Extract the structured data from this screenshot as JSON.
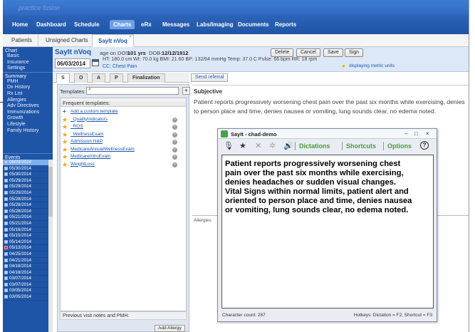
{
  "app": {
    "brand": "practice fusion"
  },
  "mainnav": {
    "items": [
      {
        "label": "Home"
      },
      {
        "label": "Dashboard"
      },
      {
        "label": "Schedule"
      },
      {
        "label": "Charts"
      },
      {
        "label": "eRx"
      },
      {
        "label": "Messages"
      },
      {
        "label": "Labs/Imaging"
      },
      {
        "label": "Documents"
      },
      {
        "label": "Reports"
      }
    ],
    "active": "Charts"
  },
  "subtabs": {
    "items": [
      {
        "label": "Patients"
      },
      {
        "label": "Unsigned Charts"
      },
      {
        "label": "SayIt nVoq"
      }
    ],
    "close_glyph": "×"
  },
  "sidebar": {
    "chart_head": "Chart",
    "chart_items": [
      "Basic",
      "Insurance",
      "Settings"
    ],
    "summary_head": "Summary",
    "summary_items": [
      "PMH",
      "Dx History",
      "Rx List",
      "Allergies",
      "Adv Directives",
      "Immunizations",
      "Growth",
      "Lifestyle",
      "Family History"
    ],
    "events_head": "Events",
    "events": [
      {
        "date": "06/03/2014",
        "selected": true
      },
      {
        "date": "05/30/2014"
      },
      {
        "date": "05/30/2014"
      },
      {
        "date": "05/29/2014"
      },
      {
        "date": "05/29/2014"
      },
      {
        "date": "05/29/2014"
      },
      {
        "date": "05/28/2014"
      },
      {
        "date": "05/28/2014"
      },
      {
        "date": "05/28/2014"
      },
      {
        "date": "05/21/2014"
      },
      {
        "date": "05/21/2014"
      },
      {
        "date": "05/16/2014"
      },
      {
        "date": "05/15/2014"
      },
      {
        "date": "05/14/2014"
      },
      {
        "date": "05/13/2014",
        "red": true
      },
      {
        "date": "04/25/2014"
      },
      {
        "date": "04/21/2014"
      },
      {
        "date": "04/18/2014"
      },
      {
        "date": "04/18/2014"
      },
      {
        "date": "03/07/2014"
      },
      {
        "date": "03/07/2014"
      },
      {
        "date": "03/05/2014"
      },
      {
        "date": "03/05/2014"
      }
    ]
  },
  "patient": {
    "name": "SayIt nVoq",
    "age_label": "age on DOS",
    "age": "101 yrs",
    "dob_label": "DOB:",
    "dob": "12/12/1912",
    "visit_date": "06/03/2014",
    "vitals": "HT: 180.0 cm  Wt: 70.0 kg  BMI: 21.60  BP: 132/64 mmHg  Temp: 37.0 C  Pulse: 66 bpm  RR: 18 rpm",
    "cc": "CC: Chest Pain",
    "metric_note": "displaying metric units"
  },
  "header_buttons": {
    "delete": "Delete",
    "cancel": "Cancel",
    "save": "Save",
    "sign": "Sign"
  },
  "soap_tabs": [
    "S",
    "O",
    "A",
    "P",
    "Finalization"
  ],
  "send_referral": "Send referral",
  "templates": {
    "label": "Templates:",
    "search_value": "",
    "add_glyph": "+",
    "list_head": "Frequent templates:",
    "add_custom": "Add a custom template",
    "items": [
      "_QualityIndicators",
      "_ROS",
      "_WellnessExam",
      "Admission H&P",
      "MedicareAnnualWellnessExam",
      "MedicareIntroExam",
      "WeightLoss"
    ],
    "prev_visit": "Previous visit notes and PMH:",
    "add_allergy": "Add Allergy"
  },
  "subjective": {
    "title": "Subjective",
    "text": "Patient reports progressively worsening chest pain over the past six months while exercising, denies\nto person place and time, denies nausea or vomiting, lung sounds clear, no edema noted."
  },
  "allergies_label": "Allergies",
  "dictation": {
    "title": "SayIt - chad-demo",
    "win_min": "–",
    "win_max": "□",
    "win_close": "×",
    "dictations": "Dictations",
    "shortcuts": "Shortcuts",
    "options": "Options",
    "help": "?",
    "text": "Patient reports progressively worsening chest\npain over the past six months while exercising,\ndenies headaches or sudden visual changes.\nVital Signs within normal limits, patient alert and\noriented to person place and time, denies nausea\nor vomiting, lung sounds clear, no edema noted.",
    "char_count": "Character count: 287",
    "hotkeys": "Hotkeys: Dictation = F2, Shortcut = F3"
  }
}
